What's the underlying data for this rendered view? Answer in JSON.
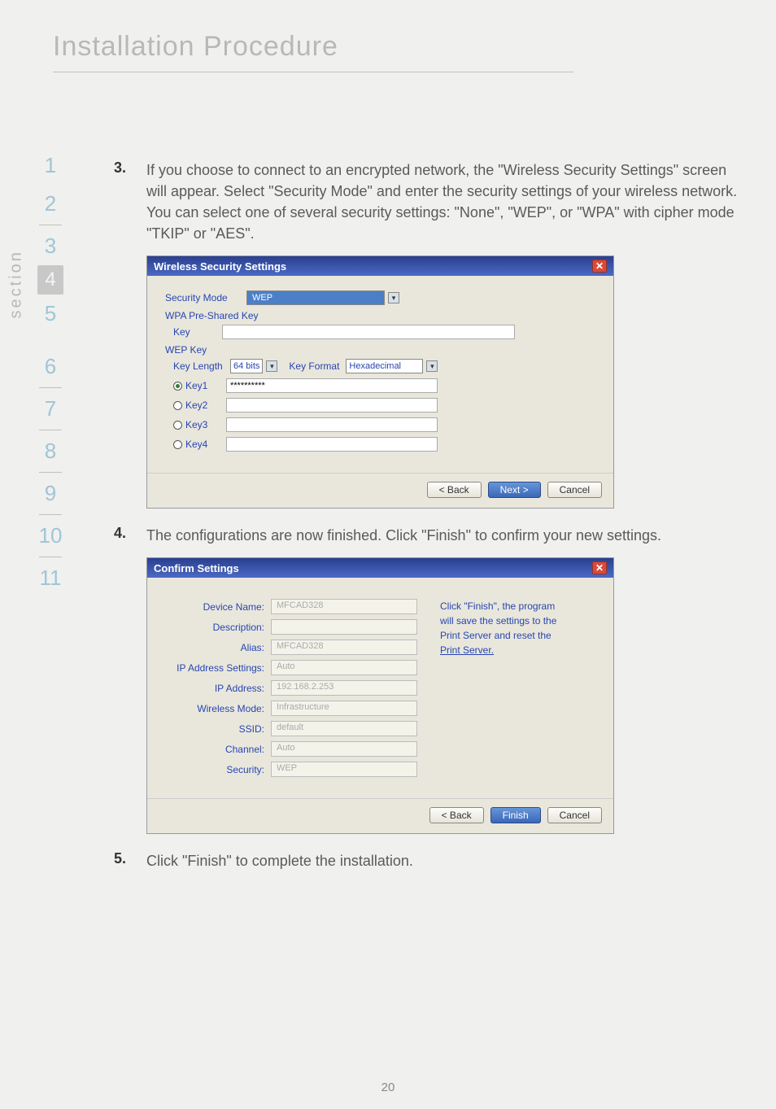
{
  "page": {
    "title": "Installation Procedure",
    "section_label": "section",
    "page_number": "20"
  },
  "sidebar": {
    "items": [
      "1",
      "2",
      "3",
      "4",
      "5",
      "6",
      "7",
      "8",
      "9",
      "10",
      "11"
    ],
    "active_index": 3
  },
  "steps": {
    "s3": {
      "num": "3.",
      "text": "If you choose to connect to an encrypted network, the \"Wireless Security Settings\" screen will appear. Select \"Security Mode\" and enter the security settings of your wireless network. You can select one of several security settings: \"None\", \"WEP\", or \"WPA\" with cipher mode \"TKIP\" or \"AES\"."
    },
    "s4": {
      "num": "4.",
      "text": "The configurations are now finished. Click \"Finish\" to confirm your new settings."
    },
    "s5": {
      "num": "5.",
      "text": "Click \"Finish\" to complete the installation."
    }
  },
  "dialog1": {
    "title": "Wireless Security Settings",
    "security_mode_label": "Security Mode",
    "security_mode_value": "WEP",
    "wpa_header": "WPA Pre-Shared Key",
    "key_label": "Key",
    "key_value": "",
    "wep_header": "WEP Key",
    "key_length_label": "Key Length",
    "key_length_value": "64 bits",
    "key_format_label": "Key Format",
    "key_format_value": "Hexadecimal",
    "keys": [
      {
        "label": "Key1",
        "value": "**********",
        "checked": true
      },
      {
        "label": "Key2",
        "value": "",
        "checked": false
      },
      {
        "label": "Key3",
        "value": "",
        "checked": false
      },
      {
        "label": "Key4",
        "value": "",
        "checked": false
      }
    ],
    "back": "< Back",
    "next": "Next >",
    "cancel": "Cancel"
  },
  "dialog2": {
    "title": "Confirm Settings",
    "fields": {
      "device_name": {
        "label": "Device Name:",
        "value": "MFCAD328"
      },
      "description": {
        "label": "Description:",
        "value": ""
      },
      "alias": {
        "label": "Alias:",
        "value": "MFCAD328"
      },
      "ip_settings": {
        "label": "IP Address Settings:",
        "value": "Auto"
      },
      "ip_address": {
        "label": "IP Address:",
        "value": "192.168.2.253"
      },
      "wireless_mode": {
        "label": "Wireless Mode:",
        "value": "Infrastructure"
      },
      "ssid": {
        "label": "SSID:",
        "value": "default"
      },
      "channel": {
        "label": "Channel:",
        "value": "Auto"
      },
      "security": {
        "label": "Security:",
        "value": "WEP"
      }
    },
    "hint_l1": "Click \"Finish\", the program",
    "hint_l2": "will save the settings to the",
    "hint_l3": "Print Server and reset the",
    "hint_link": "Print Server.",
    "back": "< Back",
    "finish": "Finish",
    "cancel": "Cancel"
  }
}
